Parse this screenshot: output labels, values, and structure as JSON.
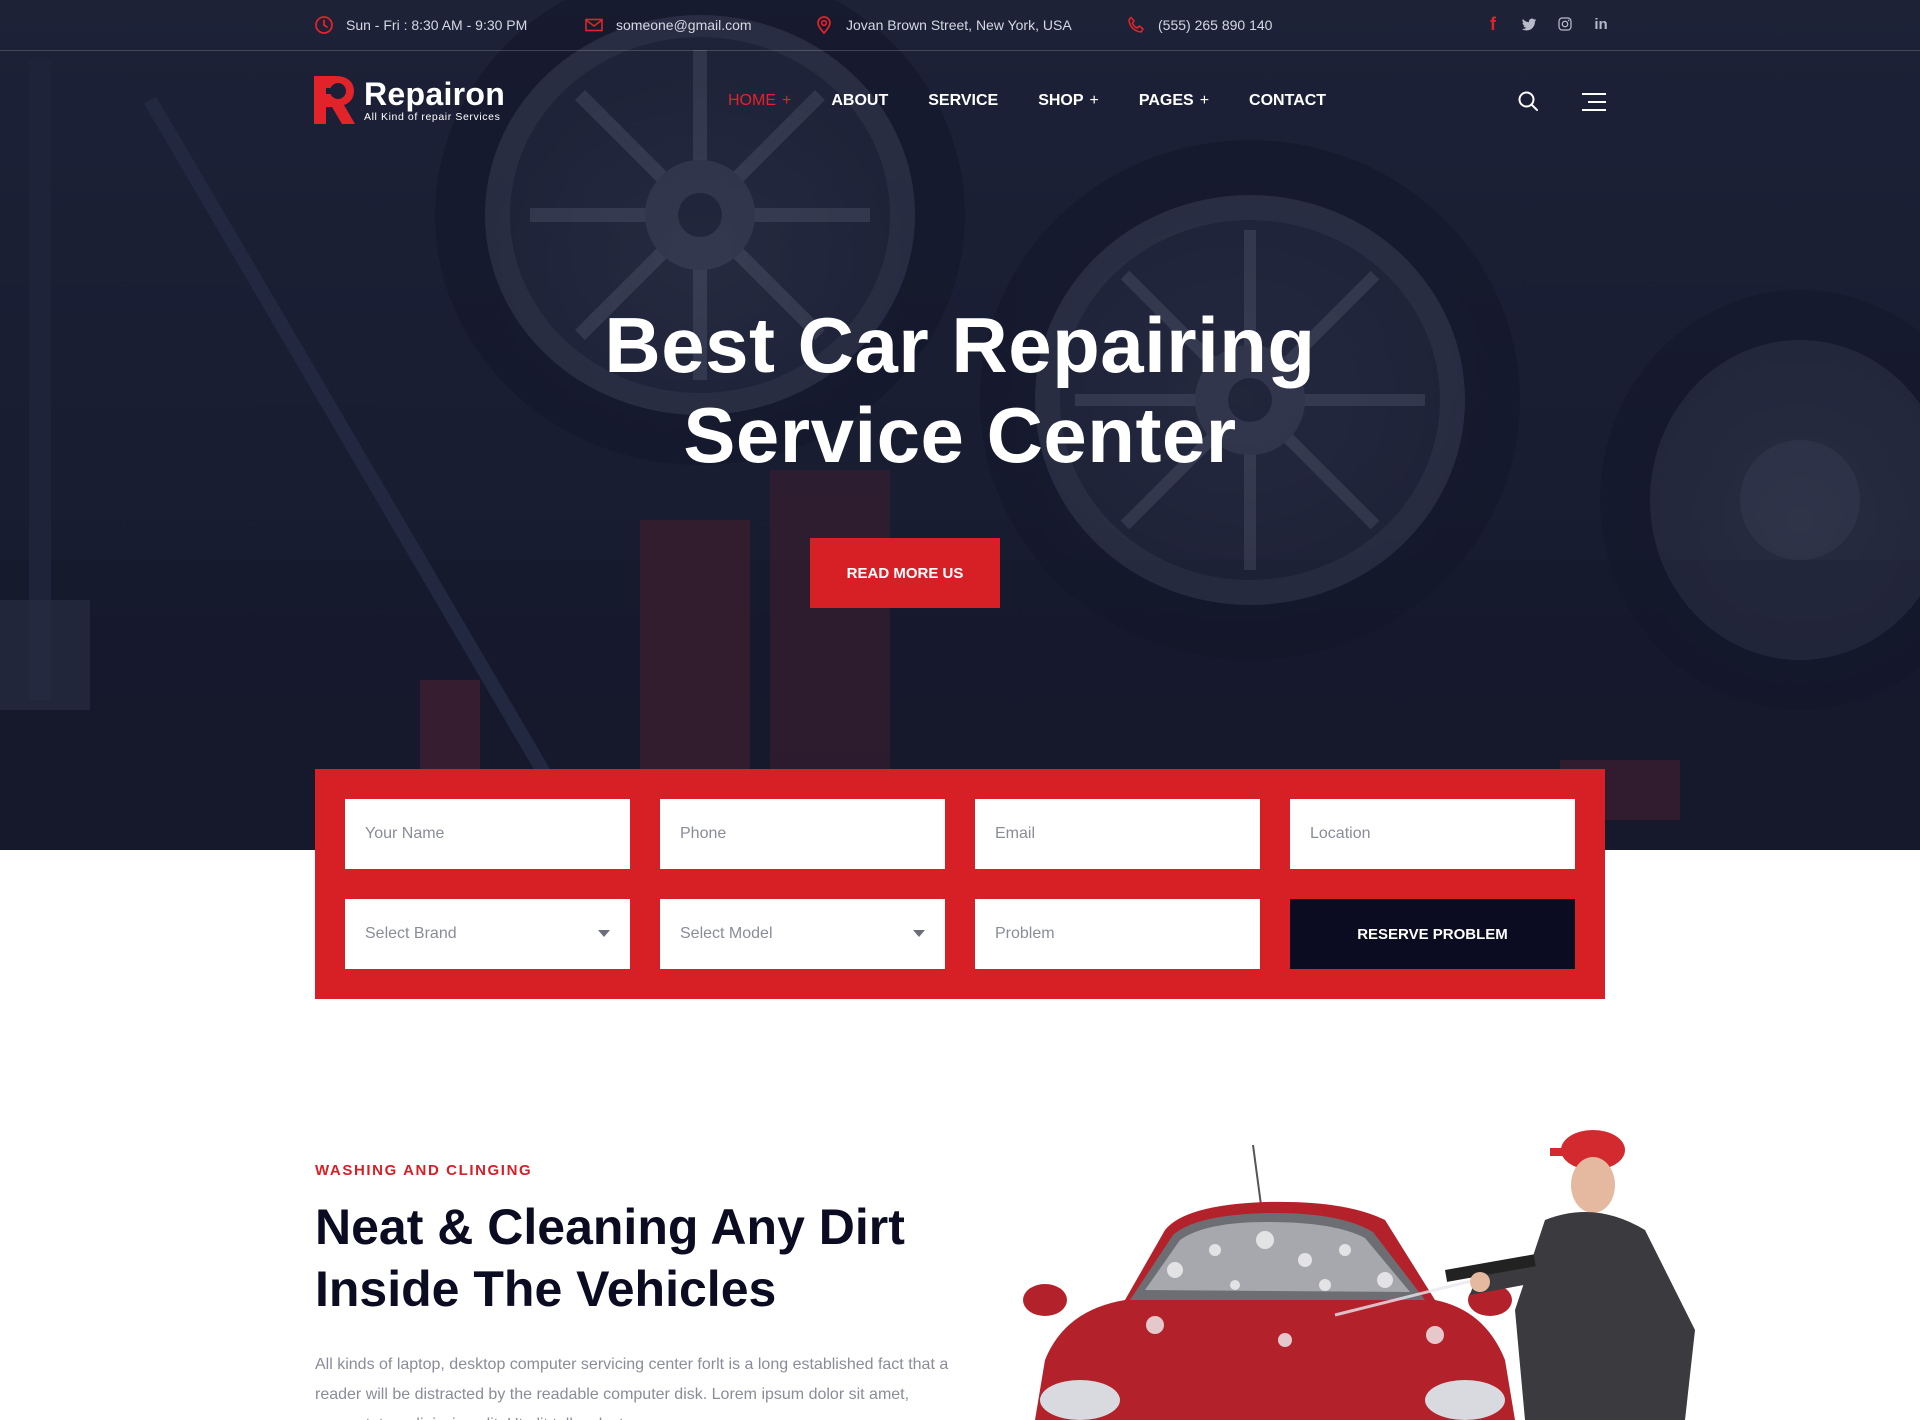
{
  "topbar": {
    "hours": "Sun - Fri : 8:30 AM - 9:30 PM",
    "email": "someone@gmail.com",
    "address": "Jovan Brown Street, New York, USA",
    "phone": "(555) 265 890 140",
    "social": [
      {
        "name": "facebook",
        "glyph": "f"
      },
      {
        "name": "twitter",
        "glyph": "t"
      },
      {
        "name": "instagram",
        "glyph": "o"
      },
      {
        "name": "linkedin",
        "glyph": "in"
      }
    ]
  },
  "brand": {
    "name": "Repairon",
    "tagline": "All Kind of repair Services",
    "accent": "#d71f26",
    "dark": "#0b0c22"
  },
  "nav": {
    "items": [
      {
        "label": "HOME",
        "has_submenu": true,
        "active": true
      },
      {
        "label": "ABOUT",
        "has_submenu": false,
        "active": false
      },
      {
        "label": "SERVICE",
        "has_submenu": false,
        "active": false
      },
      {
        "label": "SHOP",
        "has_submenu": true,
        "active": false
      },
      {
        "label": "PAGES",
        "has_submenu": true,
        "active": false
      },
      {
        "label": "CONTACT",
        "has_submenu": false,
        "active": false
      }
    ],
    "plus": "+"
  },
  "hero": {
    "title_line1": "Best Car Repairing",
    "title_line2": "Service Center",
    "button_label": "READ MORE US"
  },
  "booking": {
    "name_placeholder": "Your Name",
    "phone_placeholder": "Phone",
    "email_placeholder": "Email",
    "location_placeholder": "Location",
    "brand_select": "Select Brand",
    "model_select": "Select Model",
    "problem_placeholder": "Problem",
    "submit_label": "RESERVE PROBLEM"
  },
  "about": {
    "eyebrow": "WASHING AND CLINGING",
    "title_line1": "Neat & Cleaning Any Dirt",
    "title_line2": "Inside The Vehicles",
    "body": "All kinds of laptop, desktop computer servicing center forlt is a long established fact that a reader will be distracted by the readable computer disk. Lorem ipsum dolor sit amet, consectetur adipiscing elit. Ut elit tellus, luctus nec"
  }
}
